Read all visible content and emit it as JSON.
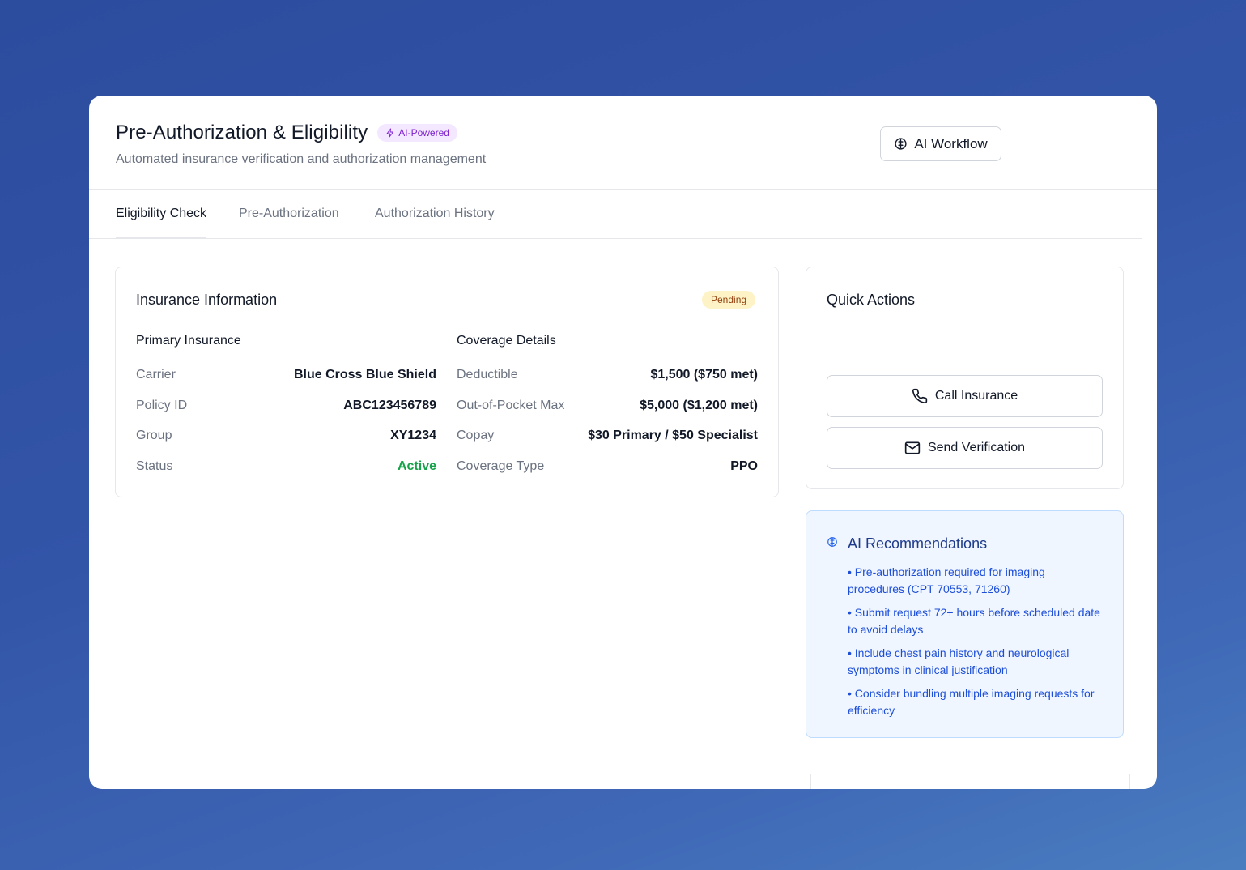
{
  "header": {
    "title": "Pre-Authorization & Eligibility",
    "badge": "AI-Powered",
    "subtitle": "Automated insurance verification and authorization management",
    "workflow_button": "AI Workflow"
  },
  "tabs": [
    {
      "label": "Eligibility Check",
      "active": true
    },
    {
      "label": "Pre-Authorization",
      "active": false
    },
    {
      "label": "Authorization History",
      "active": false
    }
  ],
  "insurance": {
    "title": "Insurance Information",
    "status_badge": "Pending",
    "primary": {
      "heading": "Primary Insurance",
      "rows": [
        {
          "label": "Carrier",
          "value": "Blue Cross Blue Shield"
        },
        {
          "label": "Policy ID",
          "value": "ABC123456789"
        },
        {
          "label": "Group",
          "value": "XY1234"
        },
        {
          "label": "Status",
          "value": "Active"
        }
      ]
    },
    "coverage": {
      "heading": "Coverage Details",
      "rows": [
        {
          "label": "Deductible",
          "value": "$1,500 ($750 met)"
        },
        {
          "label": "Out-of-Pocket Max",
          "value": "$5,000 ($1,200 met)"
        },
        {
          "label": "Copay",
          "value": "$30 Primary / $50 Specialist"
        },
        {
          "label": "Coverage Type",
          "value": "PPO"
        }
      ]
    }
  },
  "quick_actions": {
    "title": "Quick Actions",
    "call": "Call Insurance",
    "send": "Send Verification"
  },
  "ai_recommendations": {
    "title": "AI Recommendations",
    "items": [
      "• Pre-authorization required for imaging procedures (CPT 70553, 71260)",
      "• Submit request 72+ hours before scheduled date to avoid delays",
      "• Include chest pain history and neurological symptoms in clinical justification",
      "• Consider bundling multiple imaging requests for efficiency"
    ]
  },
  "colors": {
    "background": "#3355a8",
    "accent_purple": "#7e22ce",
    "active_green": "#16a34a",
    "pending_bg": "#fef3c7",
    "ai_panel_bg": "#eff6ff",
    "ai_text": "#1d4ed8"
  },
  "icons": {
    "badge": "zap-icon",
    "workflow": "brain-icon",
    "call": "phone-icon",
    "send": "mail-icon",
    "recommendations": "brain-icon"
  }
}
